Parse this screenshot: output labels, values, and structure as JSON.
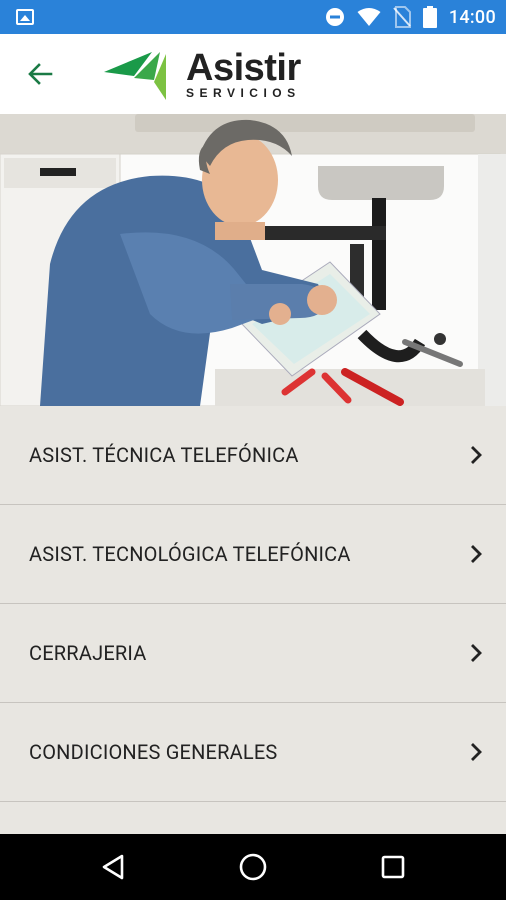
{
  "status_bar": {
    "time": "14:00",
    "icons": [
      "image-icon",
      "do-not-disturb-icon",
      "wifi-icon",
      "no-sim-icon",
      "battery-icon"
    ]
  },
  "app_bar": {
    "back_icon": "arrow-back-icon",
    "logo": {
      "title": "Asistir",
      "subtitle": "SERVICIOS",
      "colors": [
        "#1a9a49",
        "#7cc242"
      ]
    }
  },
  "hero": {
    "image": "plumber-under-sink-photo"
  },
  "menu": {
    "items": [
      {
        "label": "ASIST. TÉCNICA TELEFÓNICA",
        "icon": "chevron-right-icon"
      },
      {
        "label": "ASIST. TECNOLÓGICA TELEFÓNICA",
        "icon": "chevron-right-icon"
      },
      {
        "label": "CERRAJERIA",
        "icon": "chevron-right-icon"
      },
      {
        "label": "CONDICIONES GENERALES",
        "icon": "chevron-right-icon"
      }
    ]
  },
  "nav_bar": {
    "buttons": [
      "back-triangle-icon",
      "home-circle-icon",
      "recents-square-icon"
    ]
  },
  "colors": {
    "status_bar": "#2a82d9",
    "menu_bg": "#e8e6e1",
    "divider": "#c7c4bf",
    "brand_green": "#1a9a49"
  }
}
